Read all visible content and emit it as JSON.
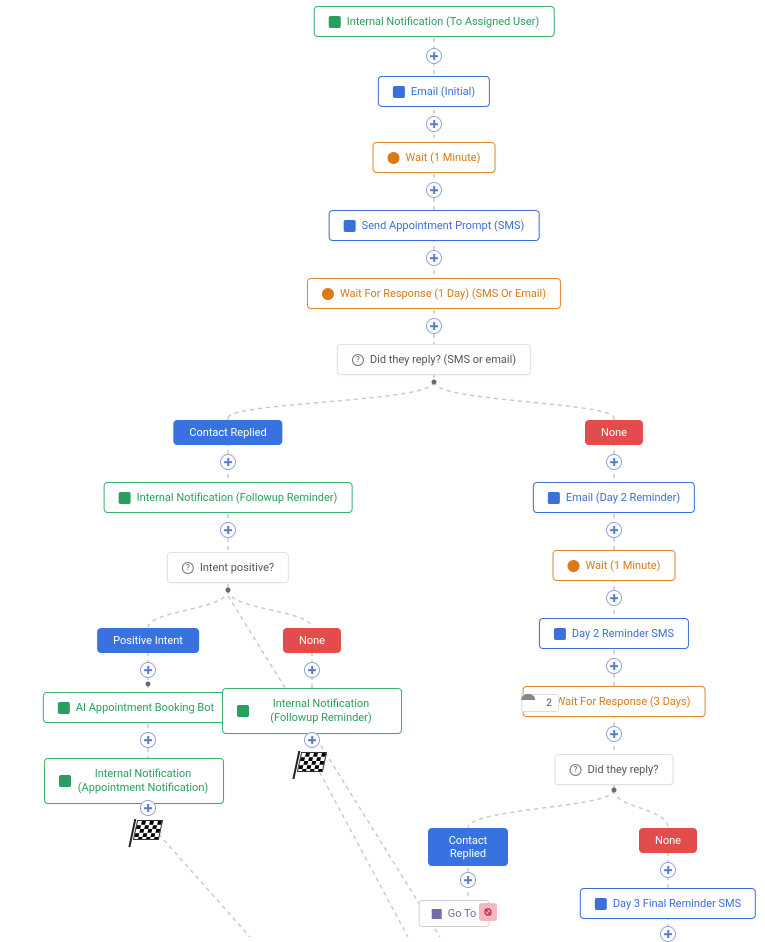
{
  "nodes": {
    "n1": "Internal Notification (To Assigned User)",
    "n2": "Email (Initial)",
    "n3": "Wait (1 Minute)",
    "n4": "Send Appointment Prompt (SMS)",
    "n5": "Wait For Response (1 Day) (SMS Or Email)",
    "n6": "Did they reply? (SMS or email)",
    "n7": "Internal Notification (Followup Reminder)",
    "n8": "Intent positive?",
    "n9": "AI Appointment Booking Bot",
    "n10": "Internal Notification (Appointment Notification)",
    "n11": "Internal Notification (Followup Reminder)",
    "n12": "Email (Day 2 Reminder)",
    "n13": "Wait (1 Minute)",
    "n14": "Day 2 Reminder SMS",
    "n15": "Wait For Response (3 Days)",
    "n16": "Did they reply?",
    "n17": "Go To",
    "n18": "Day 3 Final Reminder SMS"
  },
  "branches": {
    "contactReplied": "Contact Replied",
    "none": "None",
    "positiveIntent": "Positive Intent"
  },
  "stats": {
    "count1": "2"
  },
  "colors": {
    "green": "#2a9e5e",
    "blue": "#3b6fd9",
    "orange": "#d97a15",
    "branchBlue": "#3871e0",
    "branchRed": "#e24c4c"
  }
}
